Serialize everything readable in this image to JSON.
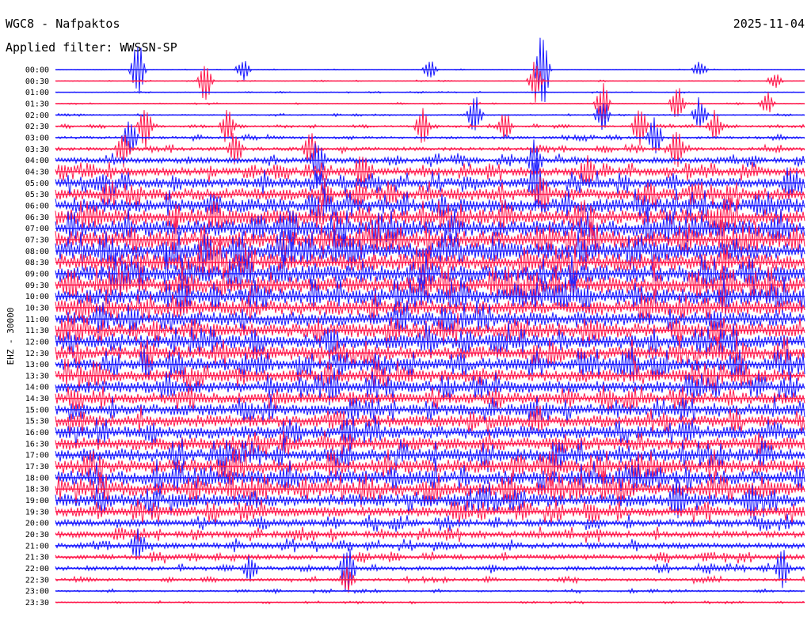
{
  "header": {
    "station": "WGC8 - Nafpaktos",
    "filter": "Applied filter: WWSSN-SP",
    "date": "2025-11-04"
  },
  "chart_data": {
    "type": "line",
    "ylabel": "EHZ - 30000",
    "colors": {
      "odd_rows": "#1a1aff",
      "even_rows": "#ff1a4d"
    },
    "categories": [
      "00:00",
      "00:30",
      "01:00",
      "01:30",
      "02:00",
      "02:30",
      "03:00",
      "03:30",
      "04:00",
      "04:30",
      "05:00",
      "05:30",
      "06:00",
      "06:30",
      "07:00",
      "07:30",
      "08:00",
      "08:30",
      "09:00",
      "09:30",
      "10:00",
      "10:30",
      "11:00",
      "11:30",
      "12:00",
      "12:30",
      "13:00",
      "13:30",
      "14:00",
      "14:30",
      "15:00",
      "15:30",
      "16:00",
      "16:30",
      "17:00",
      "17:30",
      "18:00",
      "18:30",
      "19:00",
      "19:30",
      "20:00",
      "20:30",
      "21:00",
      "21:30",
      "22:00",
      "22:30",
      "23:00",
      "23:30"
    ],
    "row_noise_level": [
      0.04,
      0.05,
      0.05,
      0.06,
      0.08,
      0.12,
      0.18,
      0.25,
      0.4,
      0.55,
      0.7,
      0.85,
      1.0,
      1.1,
      1.15,
      1.2,
      1.2,
      1.2,
      1.2,
      1.15,
      1.1,
      1.05,
      1.0,
      1.0,
      1.0,
      0.95,
      0.9,
      0.9,
      0.85,
      0.8,
      0.8,
      0.85,
      0.9,
      0.9,
      0.95,
      1.0,
      1.0,
      1.0,
      0.9,
      0.7,
      0.5,
      0.45,
      0.4,
      0.35,
      0.3,
      0.2,
      0.12,
      0.08
    ],
    "events": [
      {
        "row": 0,
        "x": 0.11,
        "amp": 2.2
      },
      {
        "row": 0,
        "x": 0.25,
        "amp": 0.8
      },
      {
        "row": 0,
        "x": 0.5,
        "amp": 0.7
      },
      {
        "row": 0,
        "x": 0.65,
        "amp": 3.0
      },
      {
        "row": 0,
        "x": 0.86,
        "amp": 0.6
      },
      {
        "row": 1,
        "x": 0.2,
        "amp": 1.8
      },
      {
        "row": 1,
        "x": 0.64,
        "amp": 1.5
      },
      {
        "row": 1,
        "x": 0.96,
        "amp": 0.6
      },
      {
        "row": 3,
        "x": 0.73,
        "amp": 1.6
      },
      {
        "row": 3,
        "x": 0.83,
        "amp": 1.4
      },
      {
        "row": 3,
        "x": 0.95,
        "amp": 0.8
      },
      {
        "row": 4,
        "x": 0.56,
        "amp": 1.5
      },
      {
        "row": 4,
        "x": 0.73,
        "amp": 1.2
      },
      {
        "row": 4,
        "x": 0.86,
        "amp": 1.3
      },
      {
        "row": 5,
        "x": 0.12,
        "amp": 1.6
      },
      {
        "row": 5,
        "x": 0.23,
        "amp": 1.4
      },
      {
        "row": 5,
        "x": 0.49,
        "amp": 1.3
      },
      {
        "row": 5,
        "x": 0.6,
        "amp": 1.2
      },
      {
        "row": 5,
        "x": 0.78,
        "amp": 1.8
      },
      {
        "row": 5,
        "x": 0.88,
        "amp": 1.2
      },
      {
        "row": 6,
        "x": 0.1,
        "amp": 1.4
      },
      {
        "row": 6,
        "x": 0.8,
        "amp": 1.6
      },
      {
        "row": 7,
        "x": 0.09,
        "amp": 1.2
      },
      {
        "row": 7,
        "x": 0.24,
        "amp": 1.3
      },
      {
        "row": 7,
        "x": 0.34,
        "amp": 1.2
      },
      {
        "row": 7,
        "x": 0.83,
        "amp": 1.4
      },
      {
        "row": 8,
        "x": 0.35,
        "amp": 1.5
      },
      {
        "row": 8,
        "x": 0.64,
        "amp": 1.2
      },
      {
        "row": 9,
        "x": 0.41,
        "amp": 1.2
      },
      {
        "row": 9,
        "x": 0.71,
        "amp": 1.0
      },
      {
        "row": 10,
        "x": 0.64,
        "amp": 1.4
      },
      {
        "row": 10,
        "x": 0.98,
        "amp": 1.1
      },
      {
        "row": 11,
        "x": 0.36,
        "amp": 1.0
      },
      {
        "row": 11,
        "x": 0.65,
        "amp": 1.3
      },
      {
        "row": 16,
        "x": 0.2,
        "amp": 1.0
      },
      {
        "row": 20,
        "x": 0.17,
        "amp": 1.1
      },
      {
        "row": 24,
        "x": 0.37,
        "amp": 1.0
      },
      {
        "row": 26,
        "x": 0.77,
        "amp": 1.2
      },
      {
        "row": 28,
        "x": 0.37,
        "amp": 1.2
      },
      {
        "row": 34,
        "x": 0.67,
        "amp": 1.2
      },
      {
        "row": 38,
        "x": 0.83,
        "amp": 1.5
      },
      {
        "row": 38,
        "x": 0.93,
        "amp": 1.3
      },
      {
        "row": 42,
        "x": 0.11,
        "amp": 1.3
      },
      {
        "row": 44,
        "x": 0.39,
        "amp": 2.0
      },
      {
        "row": 44,
        "x": 0.26,
        "amp": 0.9
      },
      {
        "row": 44,
        "x": 0.97,
        "amp": 1.4
      },
      {
        "row": 45,
        "x": 0.39,
        "amp": 1.1
      }
    ]
  }
}
